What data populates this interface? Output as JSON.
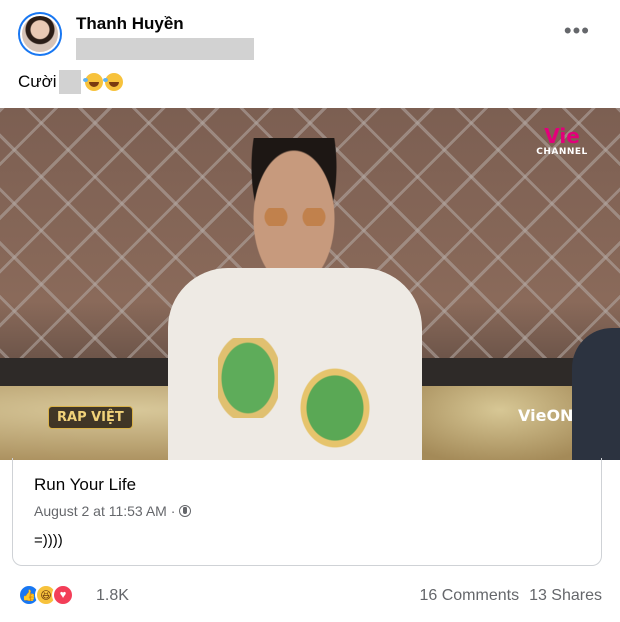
{
  "post": {
    "author": "Thanh Huyền",
    "caption": "Cười",
    "more_icon": "•••"
  },
  "video": {
    "channel_logo": "Vie",
    "channel_logo_sub": "CHANNEL",
    "show_logo": "RAP VIỆT",
    "bottom_logo": "VieON"
  },
  "shared": {
    "page_name": "Run Your Life",
    "timestamp": "August 2 at 11:53 AM · ",
    "text": "=))))"
  },
  "footer": {
    "reaction_icons": [
      "like-icon",
      "haha-icon",
      "love-icon"
    ],
    "reaction_glyphs": {
      "like": "👍",
      "haha": "😆",
      "love": "♥"
    },
    "reaction_count": "1.8K",
    "comments": "16 Comments",
    "shares": "13 Shares"
  },
  "colors": {
    "like": "#1877f2",
    "haha": "#f7c23c",
    "love": "#f33e58",
    "secondary_text": "#65676b"
  }
}
